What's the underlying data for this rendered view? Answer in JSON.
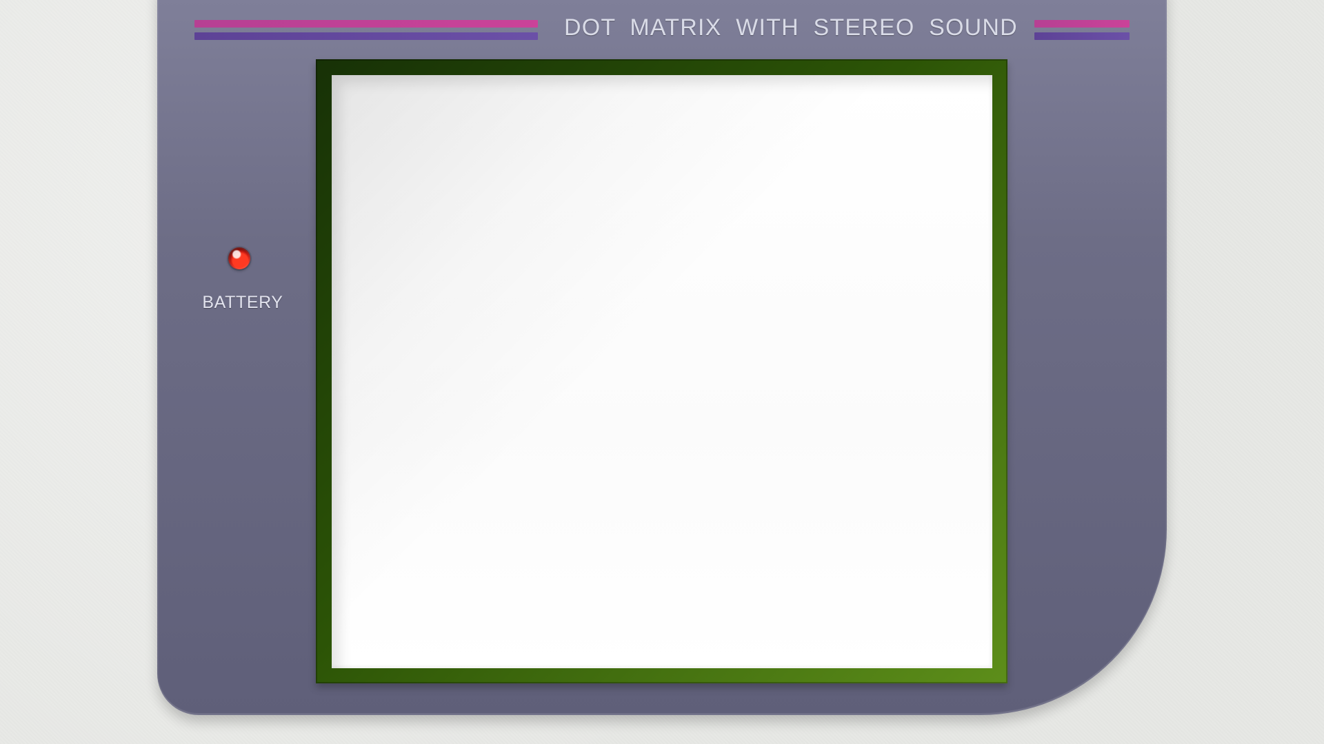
{
  "device": {
    "header_text": "DOT MATRIX WITH STEREO SOUND",
    "battery_label": "BATTERY"
  },
  "colors": {
    "background": "#e7e8e5",
    "bezel": "#6d6d86",
    "stripe_pink": "#cf3f99",
    "stripe_purple": "#5b3f96",
    "led_red": "#ff3a22",
    "screen_frame_green": "#2c5406",
    "screen": "#ffffff"
  },
  "icons": {
    "battery_led": "battery-led-icon"
  }
}
